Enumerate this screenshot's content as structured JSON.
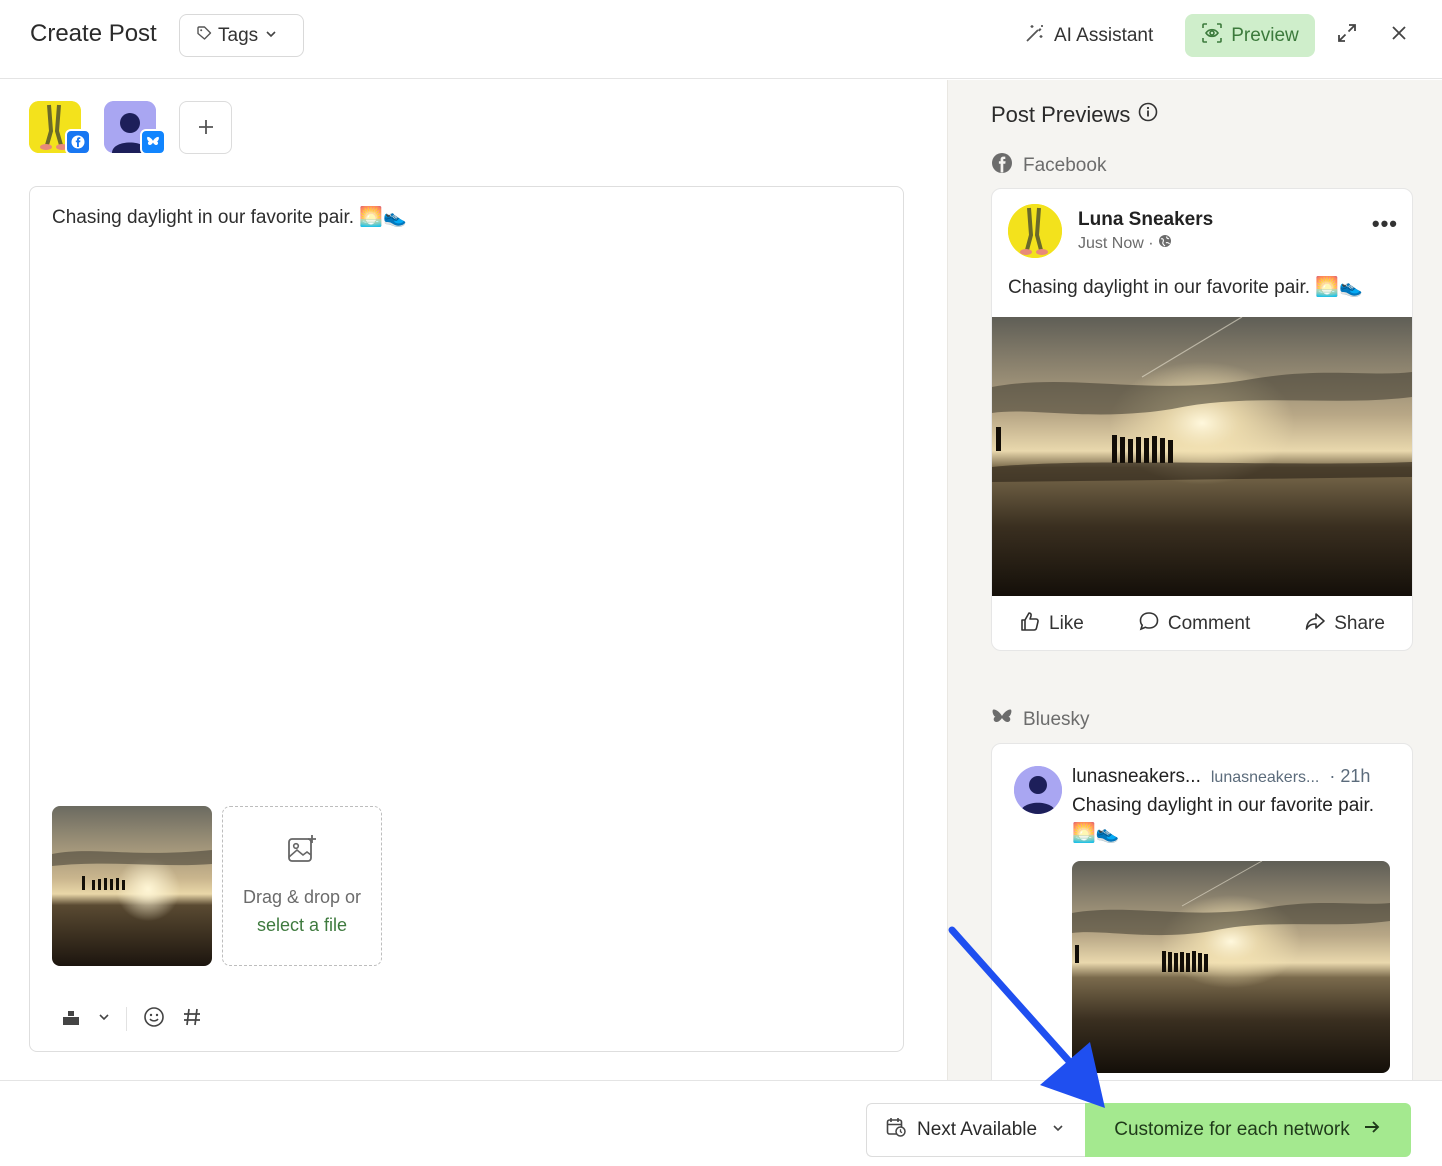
{
  "header": {
    "title": "Create Post",
    "tags_label": "Tags",
    "ai_label": "AI Assistant",
    "preview_label": "Preview"
  },
  "editor": {
    "text": "Chasing daylight in our favorite pair. 🌅👟",
    "dropzone_line1": "Drag & drop or",
    "dropzone_link": "select a file"
  },
  "previews": {
    "title": "Post Previews",
    "facebook": {
      "network_label": "Facebook",
      "page_name": "Luna Sneakers",
      "time": "Just Now ·",
      "text": "Chasing daylight in our favorite pair. 🌅👟",
      "like": "Like",
      "comment": "Comment",
      "share": "Share"
    },
    "bluesky": {
      "network_label": "Bluesky",
      "name": "lunasneakers...",
      "handle": "lunasneakers...",
      "time": "· 21h",
      "text": "Chasing daylight in our favorite pair. 🌅👟"
    }
  },
  "footer": {
    "schedule_label": "Next Available",
    "customize_label": "Customize for each network"
  },
  "colors": {
    "accent_green": "#a4e98f",
    "preview_bg": "#cfeecb",
    "facebook_blue": "#1877f2",
    "bluesky_blue": "#1185fe",
    "annotation_arrow": "#1f4ff0"
  }
}
